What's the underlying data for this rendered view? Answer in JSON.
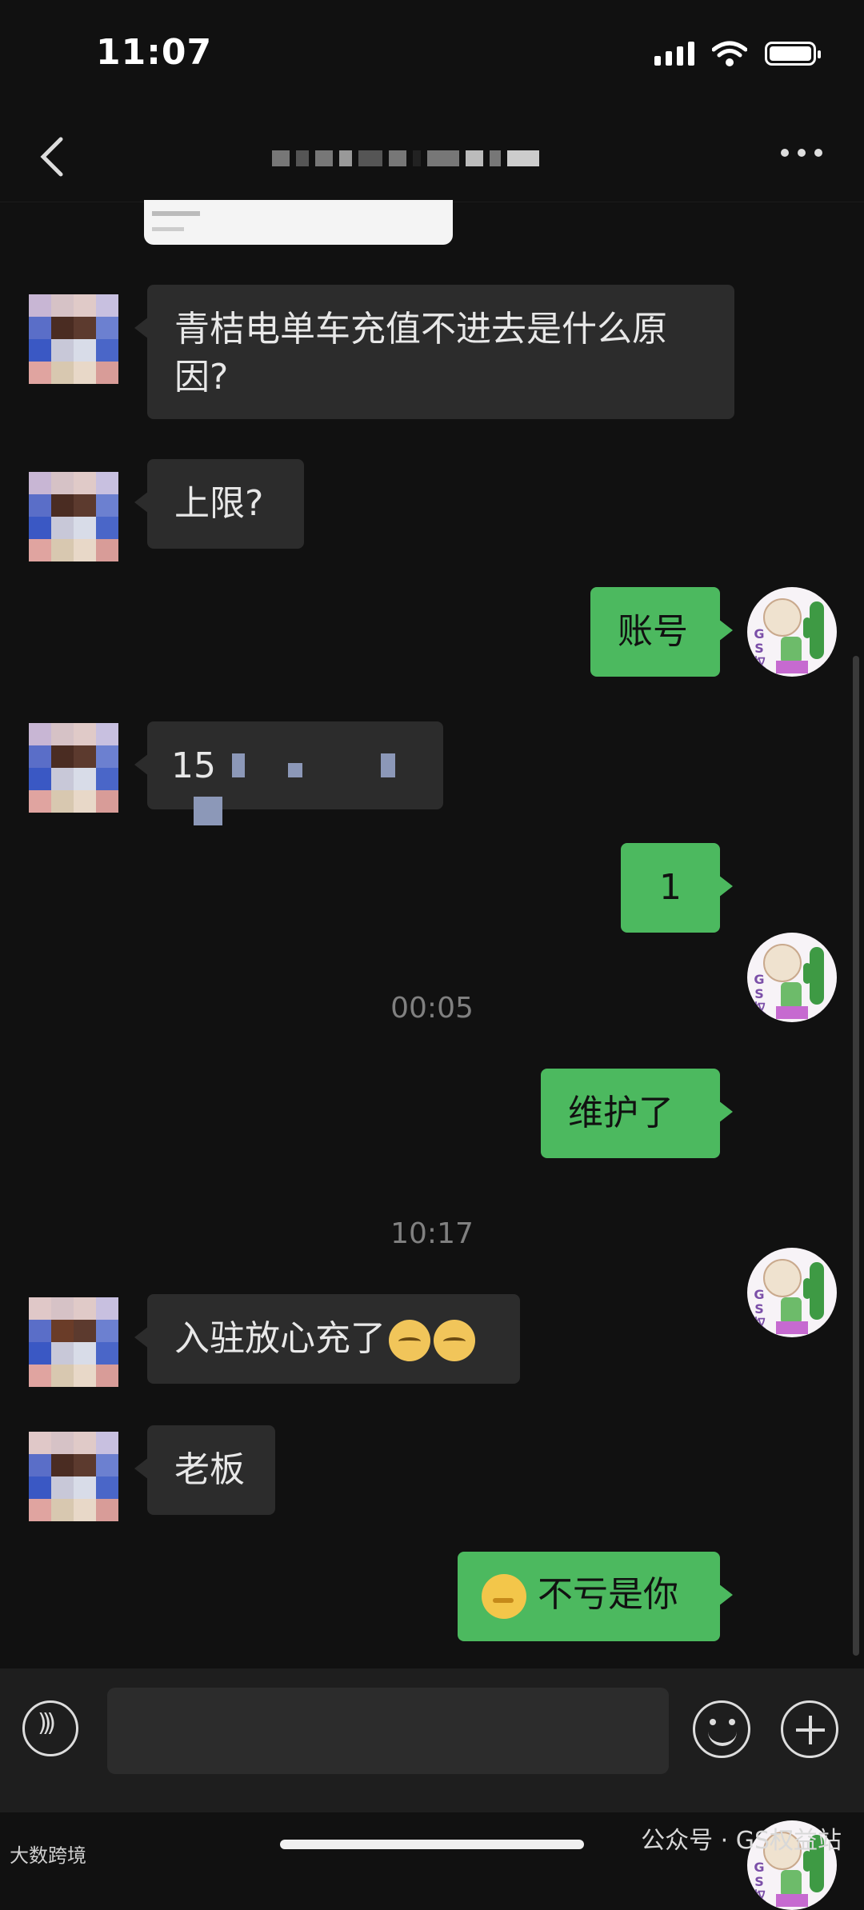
{
  "status_bar": {
    "time": "11:07"
  },
  "messages": {
    "m1": "青桔电单车充值不进去是什么原因?",
    "m2": "上限?",
    "m3": "账号",
    "m4_prefix": "15",
    "m5": "1",
    "time1": "00:05",
    "m6": "维护了",
    "time2": "10:17",
    "m7": "入驻放心充了",
    "m8": "老板",
    "m9": "不亏是你"
  },
  "input": {
    "placeholder": ""
  },
  "watermarks": {
    "left": "大数跨境",
    "right": "公众号 · GS权益站"
  },
  "colors": {
    "accent": "#4cb95f",
    "background": "#111111",
    "bubble_in": "#2c2c2c"
  },
  "icons": [
    "back-icon",
    "more-icon",
    "voice-icon",
    "emoji-icon",
    "plus-icon",
    "wifi-icon",
    "signal-icon",
    "battery-icon"
  ]
}
